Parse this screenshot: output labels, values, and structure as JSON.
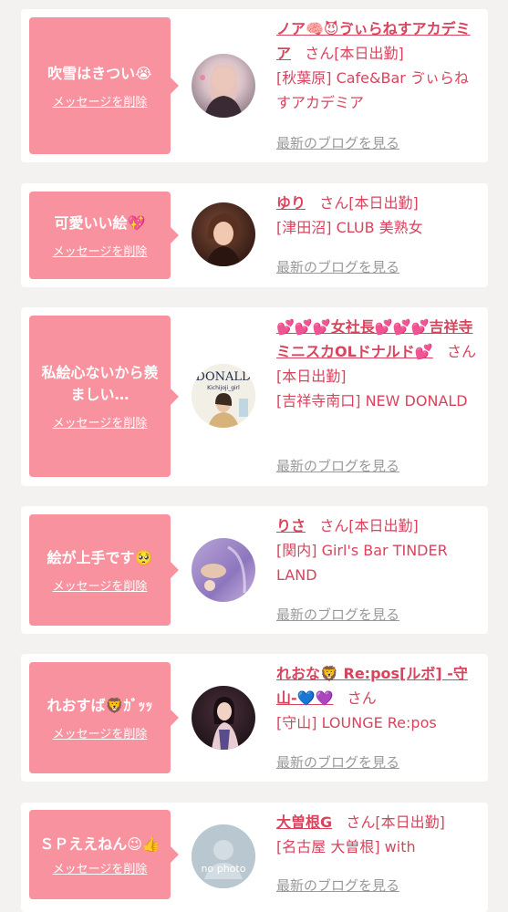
{
  "delete_label": "メッセージを削除",
  "blog_label": "最新のブログを見る",
  "san_label": "さん",
  "items": [
    {
      "message": "吹雪はきつい😭",
      "name": "ノア🧠😈ゔぃらねすアカデミア",
      "status": "[本日出勤]",
      "shop": "[秋葉原] Cafe&Bar ゔぃらねすアカデミア",
      "avatar": "avatar-photo"
    },
    {
      "message": "可愛いい絵💖",
      "name": "ゆり",
      "status": "[本日出勤]",
      "shop": "[津田沼] CLUB 美熟女",
      "avatar": "avatar-photo"
    },
    {
      "message": "私絵心ないから羨ましい…",
      "name": "💕💕💕女社長💕💕💕吉祥寺ミニスカOLドナルド💕",
      "status": "[本日出勤]",
      "shop": "[吉祥寺南口] NEW DONALD",
      "avatar": "avatar-donald-logo",
      "avatar_text": "DONALD",
      "avatar_sub": "Kichijoji_girl"
    },
    {
      "message": "絵が上手です🥺",
      "name": "りさ",
      "status": "[本日出勤]",
      "shop": "[関内] Girl's Bar TINDER LAND",
      "avatar": "avatar-photo"
    },
    {
      "message": "れおすば🦁ｶﾞｯｯ",
      "name": "れおな🦁 Re:pos[ルボ] -守山-💙💜",
      "status": "",
      "shop": "[守山] LOUNGE Re:pos",
      "avatar": "avatar-photo"
    },
    {
      "message": "ＳＰええねん😉👍",
      "name": "大曽根G",
      "status": "[本日出勤]",
      "shop": "[名古屋 大曽根] with",
      "avatar": "avatar-no-photo",
      "avatar_text": "no photo"
    }
  ]
}
